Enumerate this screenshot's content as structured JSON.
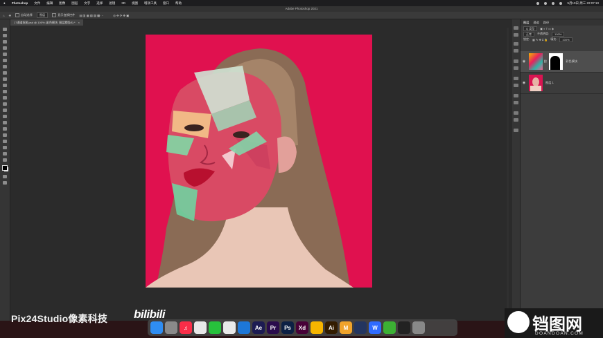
{
  "menubar": {
    "app": "Photoshop",
    "items": [
      "文件",
      "编辑",
      "图像",
      "图层",
      "文字",
      "选择",
      "滤镜",
      "3D",
      "视图",
      "增效工具",
      "窗口",
      "帮助"
    ],
    "clock": "5月10日 周三 22:07:10"
  },
  "window": {
    "title": "Adobe Photoshop 2021"
  },
  "options_bar": {
    "auto_select_label": "自动选择",
    "layer_select": "图层",
    "transform_label": "显示变换控件"
  },
  "document_tab": {
    "label": "17通道抠图.psd @ 100% (彩色模块, 图层蒙版/8) *"
  },
  "layers_panel": {
    "tabs": [
      "图层",
      "通道",
      "路径"
    ],
    "kind_label": "Q 类型",
    "blend_mode": "正常",
    "opacity_label": "不透明度:",
    "opacity_value": "100%",
    "lock_label": "锁定:",
    "fill_label": "填充:",
    "fill_value": "100%",
    "layers": [
      {
        "name": "彩色模块",
        "selected": true
      },
      {
        "name": "图层 1",
        "selected": false
      }
    ]
  },
  "watermark": {
    "left": "Pix24Studio像素科技",
    "bilibili": "bilibili",
    "right_cn": "铛图网",
    "right_en": "DOANDOAN.COM"
  },
  "dock": {
    "apps": [
      {
        "name": "finder",
        "label": "",
        "color": "#2f8df2"
      },
      {
        "name": "launchpad",
        "label": "",
        "color": "#8a8a8a"
      },
      {
        "name": "music",
        "label": "♫",
        "color": "#fa2d48"
      },
      {
        "name": "chrome",
        "label": "",
        "color": "#e8e8e8"
      },
      {
        "name": "wechat",
        "label": "",
        "color": "#27c13c"
      },
      {
        "name": "qq",
        "label": "",
        "color": "#e9e9e9"
      },
      {
        "name": "browser",
        "label": "",
        "color": "#1d77d8"
      },
      {
        "name": "after-effects",
        "label": "Ae",
        "color": "#1c1b52"
      },
      {
        "name": "premiere",
        "label": "Pr",
        "color": "#2a0c4c"
      },
      {
        "name": "photoshop",
        "label": "Ps",
        "color": "#0c2044"
      },
      {
        "name": "xd",
        "label": "Xd",
        "color": "#470137"
      },
      {
        "name": "sketch",
        "label": "",
        "color": "#f7b500"
      },
      {
        "name": "illustrator",
        "label": "Ai",
        "color": "#331c00"
      },
      {
        "name": "mindnode",
        "label": "M",
        "color": "#f0a32b"
      },
      {
        "name": "c4d",
        "label": "",
        "color": "#24355f"
      },
      {
        "name": "wps",
        "label": "W",
        "color": "#2f6bff"
      },
      {
        "name": "camtasia",
        "label": "",
        "color": "#3cb034"
      },
      {
        "name": "terminal",
        "label": "",
        "color": "#222222"
      },
      {
        "name": "trash",
        "label": "",
        "color": "#888888"
      }
    ]
  },
  "colors": {
    "canvas_bg": "#e0114f",
    "app_bg": "#2b2b2b"
  }
}
